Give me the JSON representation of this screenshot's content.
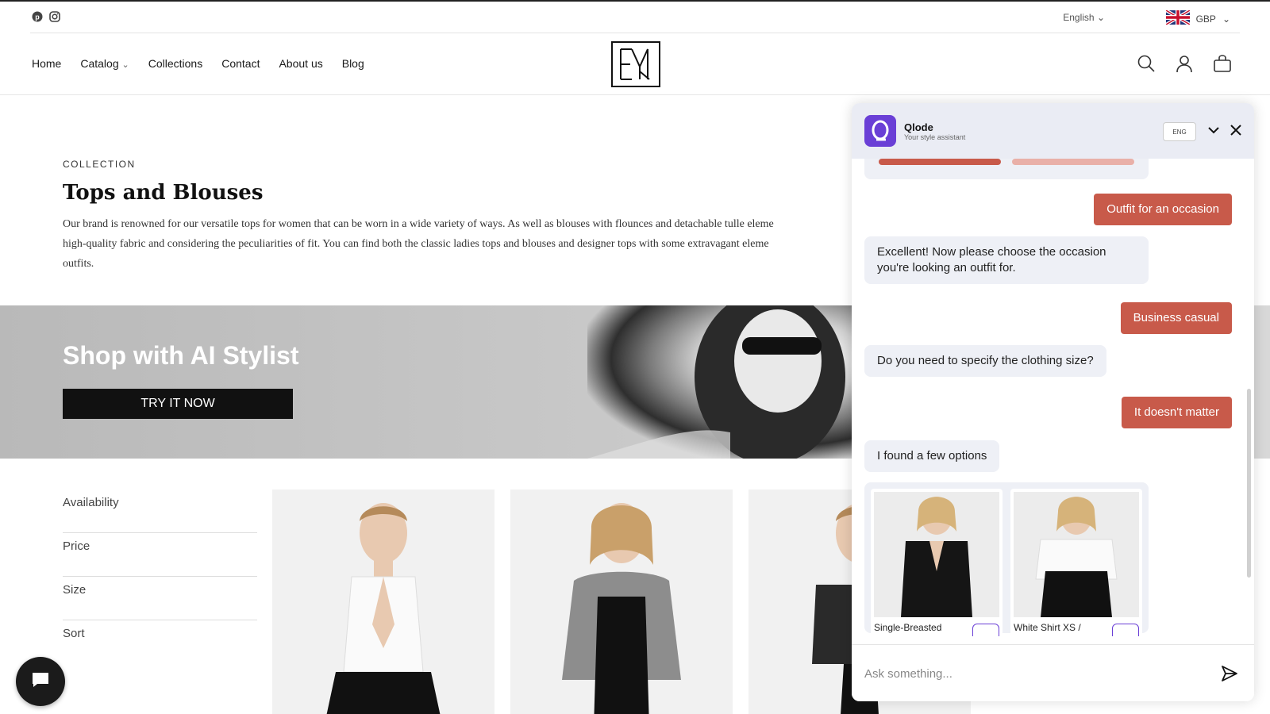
{
  "topbar": {
    "language": "English",
    "currency": "GBP"
  },
  "nav": {
    "items": [
      "Home",
      "Catalog",
      "Collections",
      "Contact",
      "About us",
      "Blog"
    ]
  },
  "collection": {
    "eyebrow": "COLLECTION",
    "title": "Tops and Blouses",
    "description_line1": "Our brand is renowned for our versatile tops  for women that can be worn in a wide variety of ways. As well as blouses with flounces and detachable tulle eleme",
    "description_line2": "high-quality fabric and considering the peculiarities of fit. You can find both the classic ladies tops and blouses  and designer tops with some extravagant eleme",
    "description_line3": "outfits."
  },
  "banner": {
    "title": "Shop with AI Stylist",
    "button": "TRY IT NOW"
  },
  "filters": [
    "Availability",
    "Price",
    "Size",
    "Sort"
  ],
  "chat": {
    "name": "Qlode",
    "subtitle": "Your style assistant",
    "lang_button": "ENG",
    "messages": [
      {
        "role": "user",
        "text": "Outfit for an occasion"
      },
      {
        "role": "bot",
        "text": "Excellent! Now please choose the occasion you're looking an outfit for."
      },
      {
        "role": "user",
        "text": "Business casual"
      },
      {
        "role": "bot",
        "text": "Do you need to specify the clothing size?"
      },
      {
        "role": "user",
        "text": "It doesn't matter"
      },
      {
        "role": "bot",
        "text": "I found a few options"
      }
    ],
    "products": [
      {
        "title": "Single-Breasted"
      },
      {
        "title": "White Shirt XS /"
      }
    ],
    "input_placeholder": "Ask something..."
  },
  "colors": {
    "accent_user_bubble": "#c85a4a",
    "brand_purple": "#6a3fd6"
  },
  "icons": [
    "pinterest-icon",
    "instagram-icon",
    "uk-flag-icon",
    "search-icon",
    "account-icon",
    "cart-icon",
    "chat-icon",
    "chevron-down-icon",
    "close-icon",
    "send-icon"
  ]
}
